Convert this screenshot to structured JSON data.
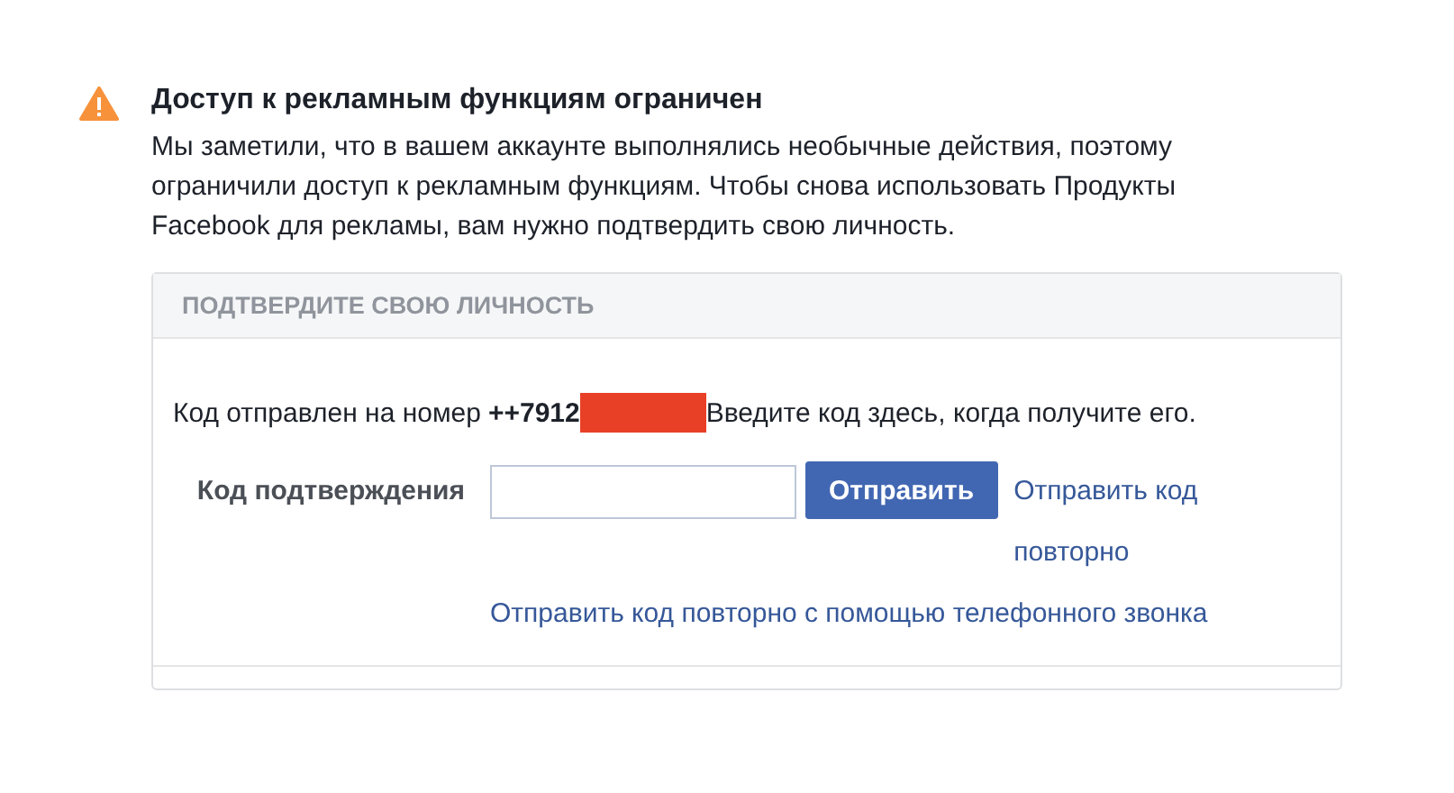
{
  "notice": {
    "title": "Доступ к рекламным функциям ограничен",
    "text": "Мы заметили, что в вашем аккаунте выполнялись необычные действия, поэтому ограничили доступ к рекламным функциям. Чтобы снова использовать Продукты Facebook для рекламы, вам нужно подтвердить свою личность."
  },
  "card": {
    "header": "ПОДТВЕРДИТЕ СВОЮ ЛИЧНОСТЬ",
    "message_before": "Код отправлен на номер",
    "phone": "++7912",
    "message_after": "Введите код здесь, когда получите его.",
    "field_label": "Код подтверждения",
    "submit_button": "Отправить",
    "resend_link": "Отправить код повторно",
    "call_link": "Отправить код повторно с помощью телефонного звонка"
  }
}
